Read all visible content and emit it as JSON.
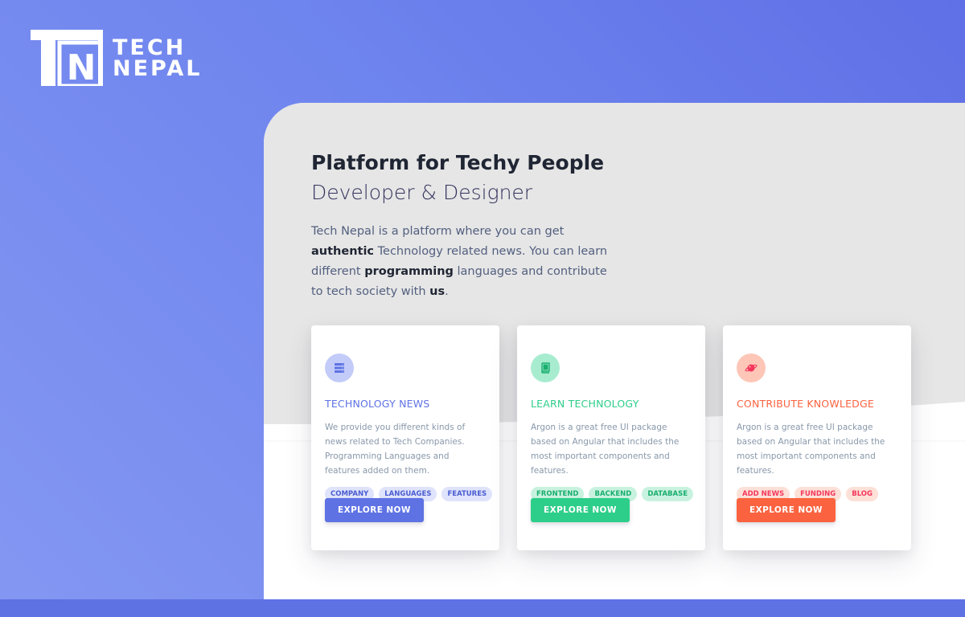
{
  "brand": {
    "mark_letters": "TN",
    "line1": "TECH",
    "line2": "NEPAL"
  },
  "hero": {
    "title": "Platform for Techy People",
    "subtitle": "Developer & Designer",
    "desc_parts": [
      "Tech Nepal is a platform where you can get ",
      "authentic",
      " Technology related news. You can learn different ",
      "programming",
      " languages and contribute to tech society with ",
      "us",
      "."
    ]
  },
  "cards": [
    {
      "title": "TECHNOLOGY NEWS",
      "icon": "server-icon",
      "accent": "#5e72e4",
      "desc": "We provide you different kinds of news related to Tech Companies. Programming Languages and features added on them.",
      "tags": [
        "COMPANY",
        "LANGUAGES",
        "FEATURES"
      ],
      "button": "EXPLORE NOW"
    },
    {
      "title": "LEARN TECHNOLOGY",
      "icon": "book-icon",
      "accent": "#2dce89",
      "desc": "Argon is a great free UI package based on Angular that includes the most important components and features.",
      "tags": [
        "FRONTEND",
        "BACKEND",
        "DATABASE"
      ],
      "button": "EXPLORE NOW"
    },
    {
      "title": "CONTRIBUTE KNOWLEDGE",
      "icon": "planet-icon",
      "accent": "#fb6340",
      "desc": "Argon is a great free UI package based on Angular that includes the most important components and features.",
      "tags": [
        "ADD NEWS",
        "FUNDING",
        "BLOG"
      ],
      "button": "EXPLORE NOW"
    }
  ],
  "colors": {
    "primary": "#5e72e4",
    "success": "#2dce89",
    "warning": "#fb6340",
    "panel_gray": "#e6e6e6"
  }
}
